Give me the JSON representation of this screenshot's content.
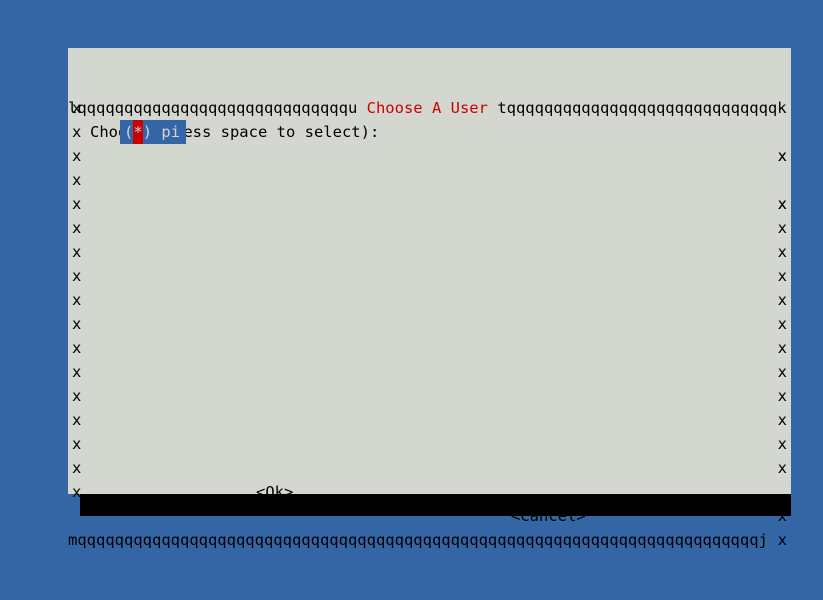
{
  "desktop": {
    "background_color": "#3465a4"
  },
  "dialog": {
    "background_color": "#d3d7cf",
    "text_color": "#000000",
    "shadow_color": "#000000",
    "title": "Choose A User",
    "title_color": "#cc0000",
    "prompt": "Choose (press space to select):",
    "border": {
      "top": "lqqqqqqqqqqqqqqqqqqqqqqqqqqqqqu",
      "top_right": "tqqqqqqqqqqqqqqqqqqqqqqqqqqqqqk",
      "bottom": "mqqqqqqqqqqqqqqqqqqqqqqqqqqqqqqqqqqqqqqqqqqqqqqqqqqqqqqqqqqqqqqqqqqqqqqqqqj",
      "side_left": "x",
      "side_right": "x"
    },
    "list": {
      "selected_index": 0,
      "items": [
        {
          "open_paren": "(",
          "mark": "*",
          "close_paren": ")",
          "label": "pi",
          "selected": true,
          "highlight_color": "#3465a4",
          "mark_color": "#cc0000"
        }
      ]
    },
    "buttons": {
      "ok_label": "<Ok>",
      "cancel_label": "<Cancel>"
    }
  }
}
